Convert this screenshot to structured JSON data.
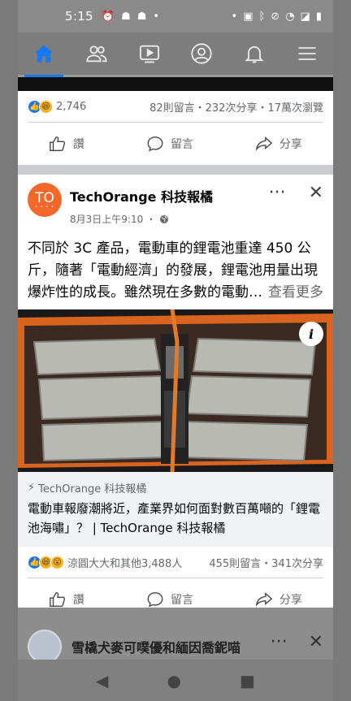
{
  "status_bar": {
    "time": "5:15",
    "left_icons": [
      "alarm-icon",
      "android-icon",
      "android-icon",
      "dot-icon"
    ],
    "right_icons": [
      "dot-icon",
      "cast-icon",
      "bluetooth-icon",
      "vibrate-icon",
      "wifi-icon",
      "no-signal-icon",
      "battery-icon"
    ]
  },
  "nav": {
    "items": [
      {
        "name": "home",
        "icon": "home-icon",
        "active": true
      },
      {
        "name": "friends",
        "icon": "friends-icon"
      },
      {
        "name": "watch",
        "icon": "watch-icon"
      },
      {
        "name": "profile",
        "icon": "profile-icon"
      },
      {
        "name": "notifications",
        "icon": "bell-icon"
      },
      {
        "name": "menu",
        "icon": "menu-icon"
      }
    ],
    "accent": "#1877f2"
  },
  "post1": {
    "reaction_count": "2,746",
    "stats": "82則留言・232次分享・17萬次瀏覽",
    "actions": {
      "like": "讚",
      "comment": "留言",
      "share": "分享"
    }
  },
  "post2": {
    "author": "TechOrange 科技報橘",
    "avatar_text": "TO",
    "time": "8月3日上午9:10 ・",
    "text": "不同於 3C 產品，電動車的鋰電池重達 450 公斤，隨著「電動經濟」的發展，鋰電池用量出現爆炸性的成長。雖然現在多數的電動…",
    "see_more": "查看更多",
    "link_source": "TechOrange 科技報橘",
    "link_headline": "電動車報廢潮將近，產業界如何面對數百萬噸的「鋰電池海嘯」？ | TechOrange 科技報橘",
    "reactions_text": "涼圓大大和其他3,488人",
    "stats": "455則留言・341次分享",
    "actions": {
      "like": "讚",
      "comment": "留言",
      "share": "分享"
    }
  },
  "post3": {
    "author": "雪橇犬麥可噗優和緬因喬鈮喵"
  }
}
